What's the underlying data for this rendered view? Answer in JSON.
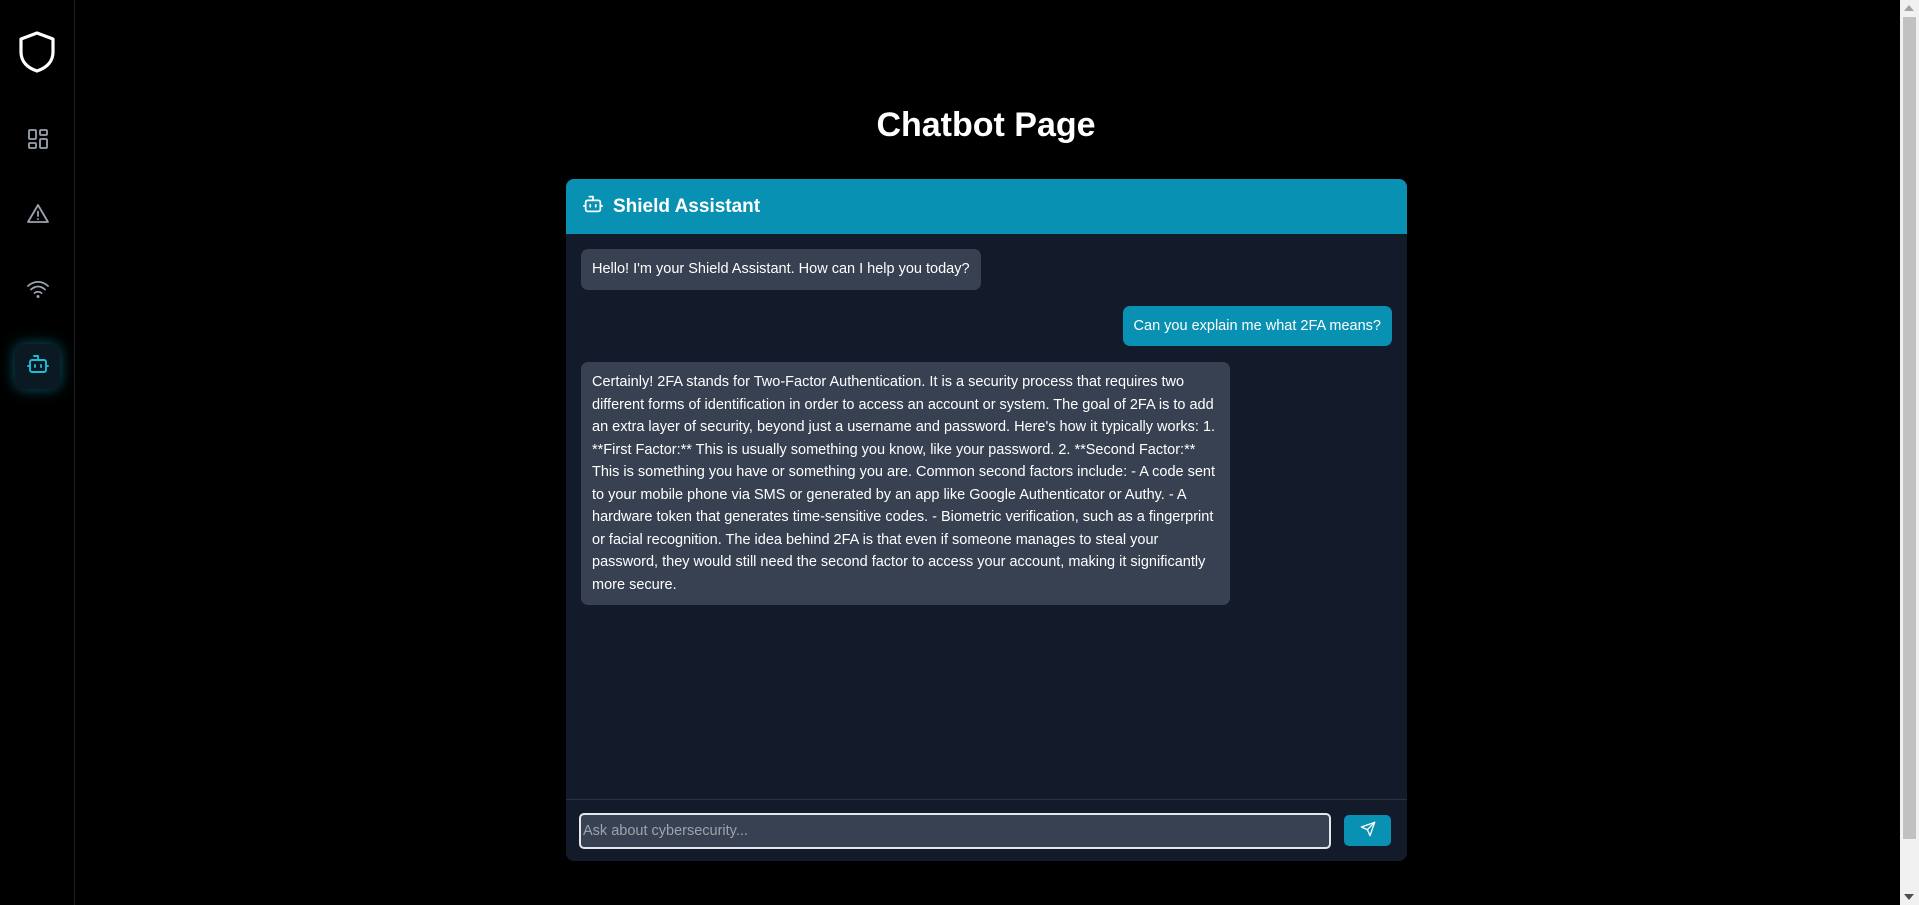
{
  "page": {
    "title": "Chatbot Page"
  },
  "sidebar": {
    "logo_icon": "shield-icon",
    "items": [
      {
        "icon": "dashboard-icon",
        "active": false
      },
      {
        "icon": "alert-triangle-icon",
        "active": false
      },
      {
        "icon": "wifi-icon",
        "active": false
      },
      {
        "icon": "bot-icon",
        "active": true
      }
    ]
  },
  "chat": {
    "header_title": "Shield Assistant",
    "header_icon": "bot-icon",
    "messages": [
      {
        "role": "bot",
        "text": "Hello! I'm your Shield Assistant. How can I help you today?"
      },
      {
        "role": "user",
        "text": "Can you explain me what 2FA means?"
      },
      {
        "role": "bot",
        "text": "Certainly! 2FA stands for Two-Factor Authentication. It is a security process that requires two different forms of identification in order to access an account or system. The goal of 2FA is to add an extra layer of security, beyond just a username and password. Here's how it typically works: 1. **First Factor:** This is usually something you know, like your password. 2. **Second Factor:** This is something you have or something you are. Common second factors include: - A code sent to your mobile phone via SMS or generated by an app like Google Authenticator or Authy. - A hardware token that generates time-sensitive codes. - Biometric verification, such as a fingerprint or facial recognition. The idea behind 2FA is that even if someone manages to steal your password, they would still need the second factor to access your account, making it significantly more secure."
      }
    ],
    "input": {
      "placeholder": "Ask about cybersecurity...",
      "value": ""
    },
    "send_icon": "send-icon"
  },
  "colors": {
    "accent": "#0891b2",
    "bot_bubble": "#374151",
    "chat_bg": "#131a29",
    "page_bg": "#000000"
  }
}
